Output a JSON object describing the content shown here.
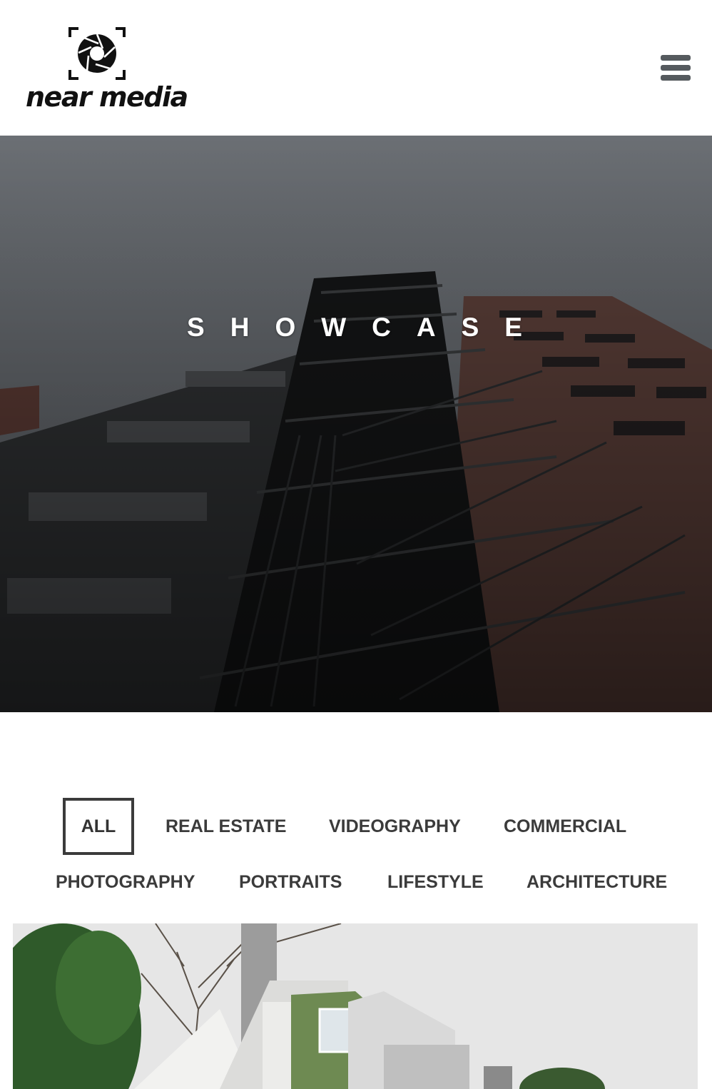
{
  "site": {
    "brand_name": "near media",
    "logo_icon": "camera-aperture-icon",
    "menu_icon": "hamburger-menu-icon"
  },
  "hero": {
    "title": "SHOWCASE"
  },
  "filters": {
    "active": "ALL",
    "items": [
      {
        "label": "ALL"
      },
      {
        "label": "REAL ESTATE"
      },
      {
        "label": "VIDEOGRAPHY"
      },
      {
        "label": "COMMERCIAL"
      },
      {
        "label": "PHOTOGRAPHY"
      },
      {
        "label": "PORTRAITS"
      },
      {
        "label": "LIFESTYLE"
      },
      {
        "label": "ARCHITECTURE"
      }
    ]
  },
  "colors": {
    "text_dark": "#3b3b3b",
    "logo": "#111111",
    "menu_icon": "#555a5e",
    "hero_overlay": "#5d6166"
  }
}
